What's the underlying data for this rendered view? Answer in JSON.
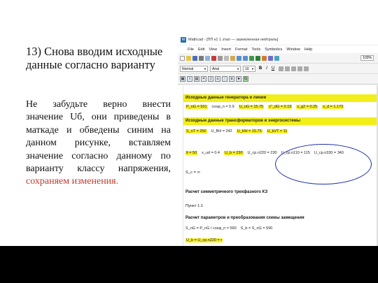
{
  "slide": {
    "heading": "13) Снова вводим исходные данные согласно варианту",
    "instructions_black": "Не забудьте верно внести значение Uб, они приведены в маткаде и обведены синим на данном рисунке, вставляем значение согласно данному по варианту классу напряжения,",
    "instructions_red": "сохраняем изменения."
  },
  "mathcad": {
    "title": "Mathcad - [ПП к1 1 этап — заземленная нейтраль]",
    "menu": [
      "File",
      "Edit",
      "View",
      "Insert",
      "Format",
      "Tools",
      "Symbolics",
      "Window",
      "Help"
    ],
    "zoom": "100%",
    "style_select": "Normal",
    "font_select": "Arial",
    "size_select": "10",
    "format_buttons": [
      "B",
      "I",
      "U"
    ],
    "section1_title": "Исходные данные генератора и линии",
    "row1": [
      "P_nG = 531",
      "cosφ_n = 0.9",
      "U_nG = 15.75",
      "x''_dG = 0.19",
      "x_g2 = 0.25",
      "x_d = 1.173"
    ],
    "section2_title": "Исходные данные трансформаторов и энергосистемы",
    "row2": [
      "S_nT = 250",
      "U_BH = 242",
      "U_HH = 15.75",
      "U_kVT = 11"
    ],
    "row3": [
      "lt = 50",
      "x_ud = 0.4",
      "U_b = 230",
      "U_cp.n220 = 230",
      "U_cp.n110 = 115",
      "U_cp.n330 = 340"
    ],
    "row4": "S_c = ∞",
    "calc_title": "Расчет симметричного трехфазного КЗ",
    "point_label": "Пункт 1.1",
    "calc2_title": "Расчет параметров и преобразования схемы замещения",
    "row5": [
      "S_nG = P_nG / cosφ_n = 590",
      "S_b = S_nG = 590"
    ],
    "row6": "U_b = U_cp.n220 = ▪"
  },
  "colors": {
    "highlight": "#f2ee1b",
    "ellipse": "#1b2fa8",
    "red_text": "#c0392b"
  }
}
